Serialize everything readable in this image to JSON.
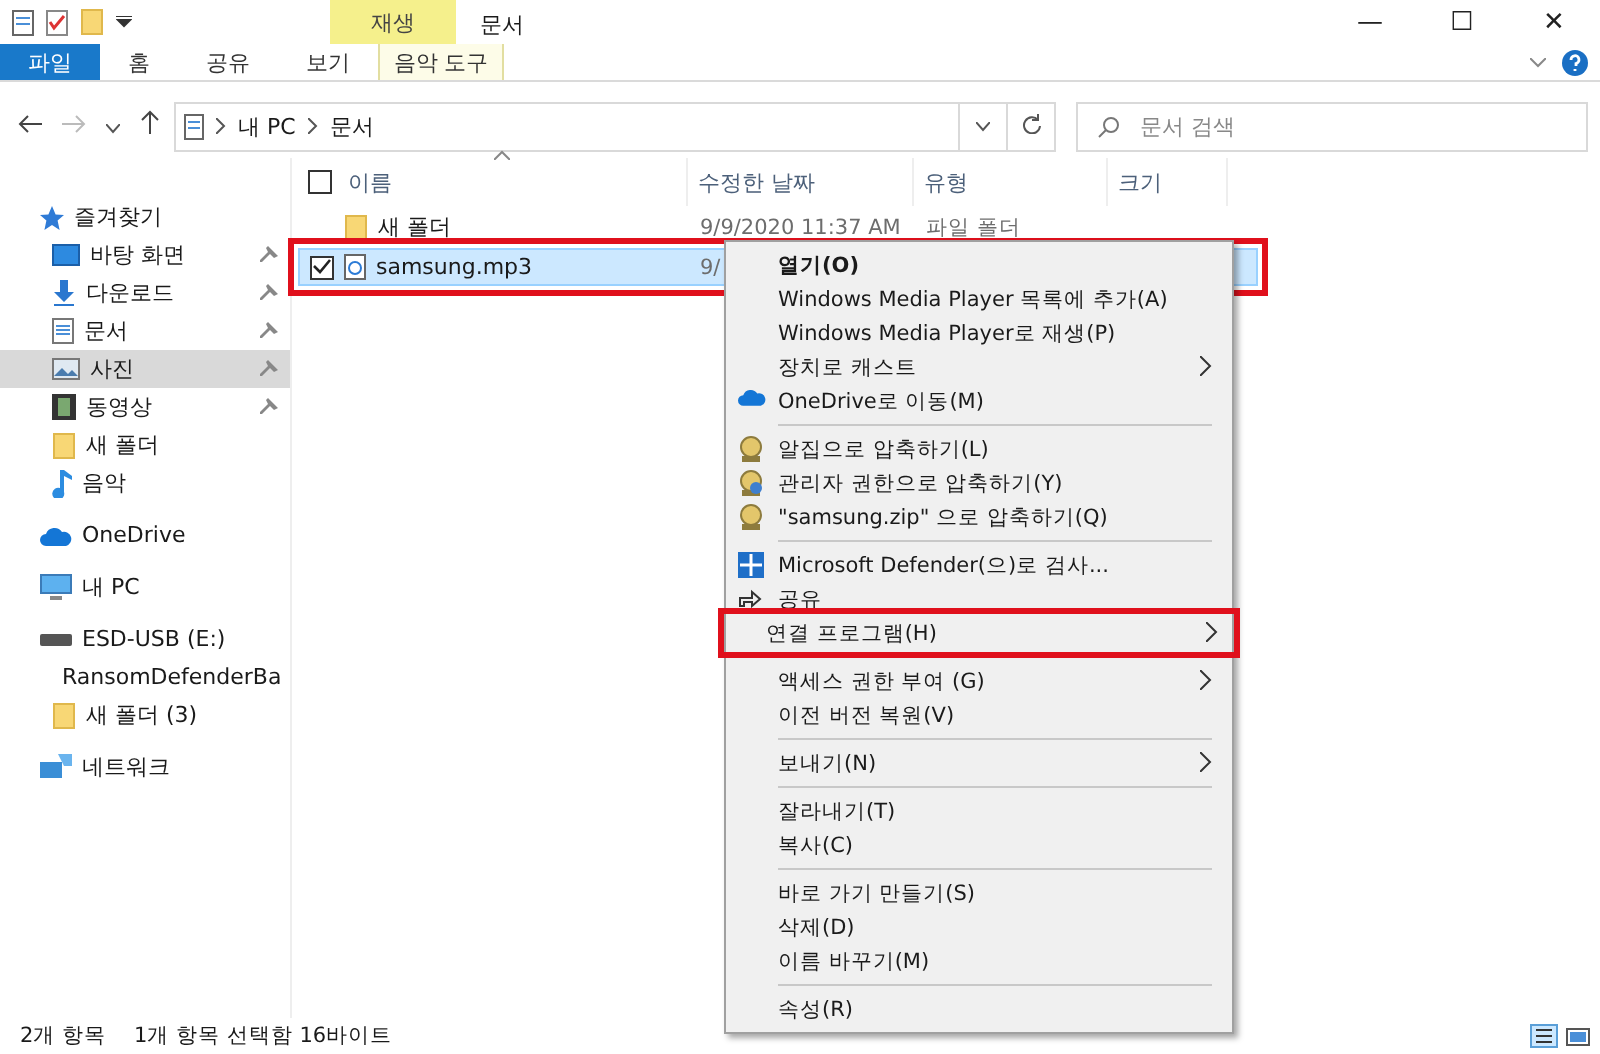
{
  "window": {
    "title": "문서",
    "context_tab": "재생",
    "controls": [
      "—",
      "☐",
      "✕"
    ]
  },
  "ribbon": {
    "tabs": [
      {
        "label": "파일",
        "selected": true
      },
      {
        "label": "홈",
        "selected": false
      },
      {
        "label": "공유",
        "selected": false
      },
      {
        "label": "보기",
        "selected": false
      },
      {
        "label": "음악 도구",
        "selected": false
      }
    ]
  },
  "address": {
    "path": [
      "내 PC",
      "문서"
    ],
    "search_placeholder": "문서 검색"
  },
  "sidebar": {
    "items": [
      {
        "label": "즐겨찾기",
        "selected": false,
        "pinned": false,
        "children": [
          {
            "label": "바탕 화면",
            "selected": false,
            "pinned": true
          },
          {
            "label": "다운로드",
            "selected": false,
            "pinned": true
          },
          {
            "label": "문서",
            "selected": false,
            "pinned": true
          },
          {
            "label": "사진",
            "selected": true,
            "pinned": true
          },
          {
            "label": "동영상",
            "selected": false,
            "pinned": true
          },
          {
            "label": "새 폴더",
            "selected": false,
            "pinned": false
          },
          {
            "label": "음악",
            "selected": false,
            "pinned": false
          }
        ]
      },
      {
        "label": "OneDrive",
        "selected": false,
        "pinned": false
      },
      {
        "label": "내 PC",
        "selected": false,
        "pinned": false
      },
      {
        "label": "ESD-USB (E:)",
        "selected": false,
        "pinned": false,
        "children": [
          {
            "label": "RansomDefenderBa",
            "selected": false
          },
          {
            "label": "새 폴더 (3)",
            "selected": false,
            "pinned": false
          }
        ]
      },
      {
        "label": "네트워크",
        "selected": false,
        "pinned": false
      }
    ]
  },
  "table": {
    "select_all_checked": false,
    "columns": [
      "이름",
      "수정한 날짜",
      "유형",
      "크기"
    ],
    "rows": [
      {
        "kind": "folder",
        "name": "새 폴더",
        "date": "9/9/2020 11:37 AM",
        "type": "파일 폴더",
        "selected": false,
        "checked": false,
        "highlighted": false
      },
      {
        "kind": "audio",
        "name": "samsung.mp3",
        "date": "9/",
        "selected": true,
        "checked": true,
        "highlighted": true
      }
    ]
  },
  "context_menu": [
    {
      "kind": "item",
      "label": "열기(O)",
      "bold": true,
      "submenu": false,
      "highlighted": false
    },
    {
      "kind": "item",
      "label": "Windows Media Player 목록에 추가(A)",
      "bold": false,
      "submenu": false,
      "highlighted": false
    },
    {
      "kind": "item",
      "label": "Windows Media Player로 재생(P)",
      "bold": false,
      "submenu": false,
      "highlighted": false
    },
    {
      "kind": "item",
      "label": "장치로 캐스트",
      "bold": false,
      "submenu": true,
      "highlighted": false
    },
    {
      "kind": "item",
      "label": "OneDrive로 이동(M)",
      "bold": false,
      "submenu": false,
      "highlighted": false
    },
    {
      "kind": "separator"
    },
    {
      "kind": "item",
      "label": "알집으로 압축하기(L)",
      "bold": false,
      "submenu": false,
      "highlighted": false
    },
    {
      "kind": "item",
      "label": "관리자 권한으로 압축하기(Y)",
      "bold": false,
      "submenu": false,
      "highlighted": false
    },
    {
      "kind": "item",
      "label": "\"samsung.zip\" 으로 압축하기(Q)",
      "bold": false,
      "submenu": false,
      "highlighted": false
    },
    {
      "kind": "separator"
    },
    {
      "kind": "item",
      "label": "Microsoft Defender(으)로 검사...",
      "bold": false,
      "submenu": false,
      "highlighted": false
    },
    {
      "kind": "item",
      "label": "공유",
      "bold": false,
      "submenu": false,
      "highlighted": false
    },
    {
      "kind": "item",
      "label": "연결 프로그램(H)",
      "bold": false,
      "submenu": true,
      "highlighted": true
    },
    {
      "kind": "separator"
    },
    {
      "kind": "item",
      "label": "액세스 권한 부여 (G)",
      "bold": false,
      "submenu": true,
      "highlighted": false
    },
    {
      "kind": "item",
      "label": "이전 버전 복원(V)",
      "bold": false,
      "submenu": false,
      "highlighted": false
    },
    {
      "kind": "separator"
    },
    {
      "kind": "item",
      "label": "보내기(N)",
      "bold": false,
      "submenu": true,
      "highlighted": false
    },
    {
      "kind": "separator"
    },
    {
      "kind": "item",
      "label": "잘라내기(T)",
      "bold": false,
      "submenu": false,
      "highlighted": false
    },
    {
      "kind": "item",
      "label": "복사(C)",
      "bold": false,
      "submenu": false,
      "highlighted": false
    },
    {
      "kind": "separator"
    },
    {
      "kind": "item",
      "label": "바로 가기 만들기(S)",
      "bold": false,
      "submenu": false,
      "highlighted": false
    },
    {
      "kind": "item",
      "label": "삭제(D)",
      "bold": false,
      "submenu": false,
      "highlighted": false
    },
    {
      "kind": "item",
      "label": "이름 바꾸기(M)",
      "bold": false,
      "submenu": false,
      "highlighted": false
    },
    {
      "kind": "separator"
    },
    {
      "kind": "item",
      "label": "속성(R)",
      "bold": false,
      "submenu": false,
      "highlighted": false
    }
  ],
  "status_bar": [
    "2개 항목",
    "1개 항목 선택함 16바이트"
  ]
}
